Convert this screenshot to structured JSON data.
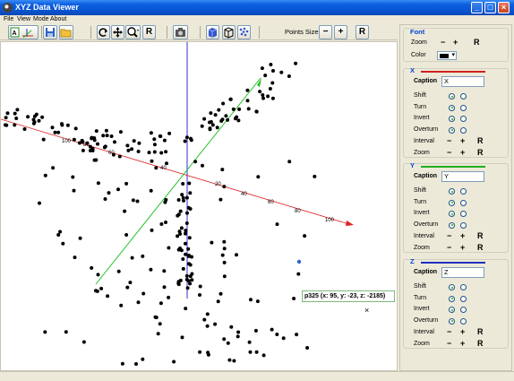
{
  "window": {
    "title": "XYZ Data Viewer",
    "controls": [
      "_",
      "□",
      "×"
    ]
  },
  "menu": [
    {
      "label": "File"
    },
    {
      "label": "View"
    },
    {
      "label": "Mode"
    },
    {
      "label": "About"
    }
  ],
  "toolbar": {
    "points_size_label": "Points Size",
    "minus": "−",
    "plus": "+",
    "reset": "R",
    "icons": [
      "axis-label-icon",
      "save-icon",
      "open-folder-icon",
      "rotate-icon",
      "move-icon",
      "zoom-icon",
      "camera-icon",
      "cube-solid-icon",
      "cube-wire-icon",
      "cube-points-icon"
    ]
  },
  "plot": {
    "tooltip": "p325 (x: 95, y: -23, z: -2185)",
    "x_ticks": [
      "20",
      "40",
      "60",
      "80",
      "100"
    ],
    "neg_ticks": [
      "100",
      "80",
      "60",
      "40"
    ],
    "axis_colors": {
      "x": "#e02020",
      "y": "#20c020",
      "z": "#3030d0"
    },
    "close_mark": "×"
  },
  "panel": {
    "font": {
      "title": "Font",
      "zoom_label": "Zoom",
      "color_label": "Color",
      "minus": "−",
      "plus": "+",
      "reset": "R"
    },
    "axes": [
      {
        "key": "X",
        "line_color": "#d02020",
        "caption_label": "Caption",
        "caption_value": "X",
        "options": [
          {
            "label": "Shift",
            "selected": 0
          },
          {
            "label": "Turn",
            "selected": 0
          },
          {
            "label": "Invert",
            "selected": 0
          },
          {
            "label": "Overturn",
            "selected": 0
          }
        ],
        "interval_label": "Interval",
        "zoom_label": "Zoom"
      },
      {
        "key": "Y",
        "line_color": "#20b020",
        "caption_label": "Caption",
        "caption_value": "Y",
        "options": [
          {
            "label": "Shift",
            "selected": 0
          },
          {
            "label": "Turn",
            "selected": 0
          },
          {
            "label": "Invert",
            "selected": 0
          },
          {
            "label": "Overturn",
            "selected": 0
          }
        ],
        "interval_label": "Interval",
        "zoom_label": "Zoom"
      },
      {
        "key": "Z",
        "line_color": "#2030c0",
        "caption_label": "Caption",
        "caption_value": "Z",
        "options": [
          {
            "label": "Shift",
            "selected": 0
          },
          {
            "label": "Turn",
            "selected": 0
          },
          {
            "label": "Invert",
            "selected": 0
          },
          {
            "label": "Overturn",
            "selected": 0
          }
        ],
        "interval_label": "Interval",
        "zoom_label": "Zoom"
      }
    ]
  }
}
